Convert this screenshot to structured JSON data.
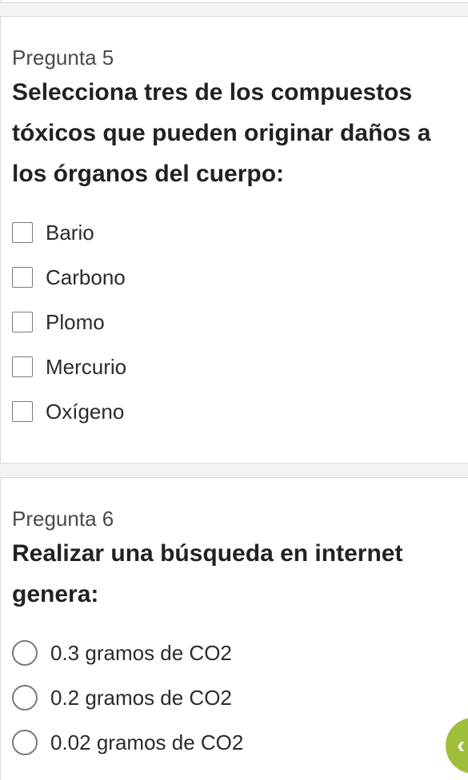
{
  "questions": [
    {
      "number": "Pregunta 5",
      "title": "Selecciona tres de los compuestos tóxicos que pueden originar daños a los órganos del cuerpo:",
      "options": [
        "Bario",
        "Carbono",
        "Plomo",
        "Mercurio",
        "Oxígeno"
      ]
    },
    {
      "number": "Pregunta 6",
      "title": "Realizar una búsqueda en internet genera:",
      "options": [
        "0.3 gramos de CO2",
        "0.2 gramos de CO2",
        "0.02 gramos de CO2"
      ]
    }
  ],
  "colors": {
    "background": "#f3f3f3",
    "card": "#ffffff",
    "accent": "#9fbf3a"
  },
  "fab": {
    "icon": "chevron-icon"
  }
}
